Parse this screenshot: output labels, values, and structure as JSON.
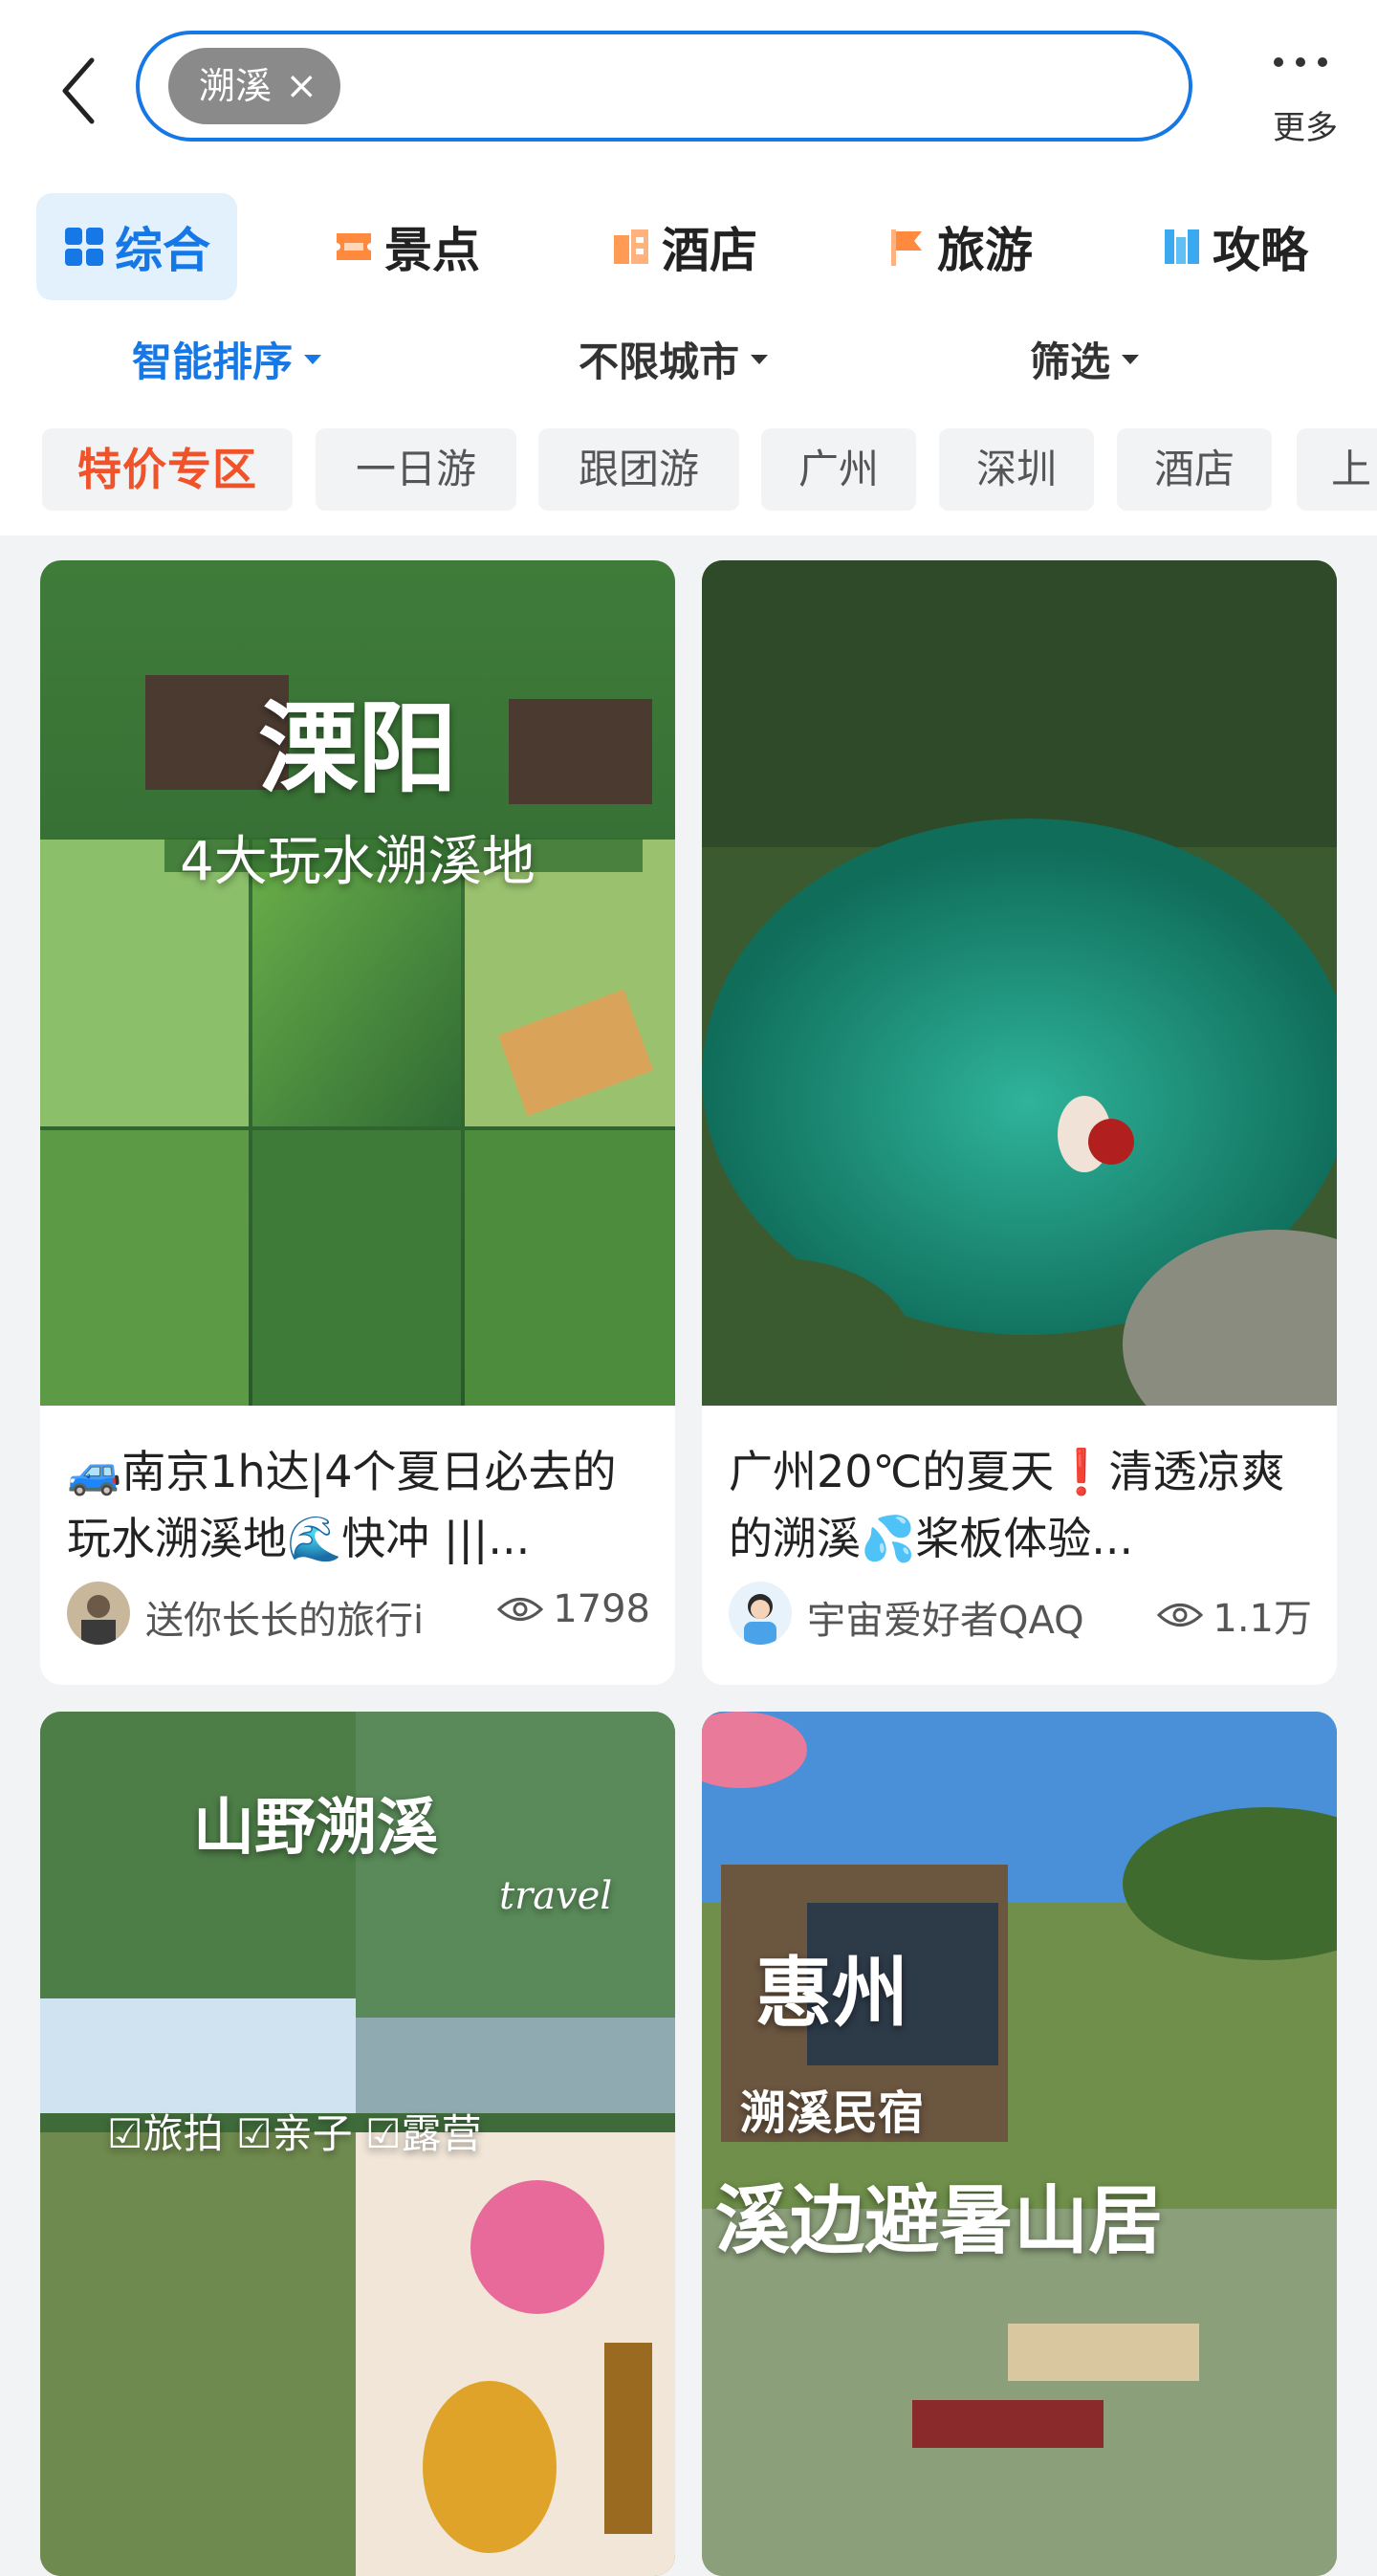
{
  "header": {
    "search_chip": "溯溪",
    "chip_close": "×",
    "more_label": "更多"
  },
  "category_tabs": [
    {
      "label": "综合",
      "icon": "grid-icon",
      "active": true
    },
    {
      "label": "景点",
      "icon": "ticket-icon",
      "active": false
    },
    {
      "label": "酒店",
      "icon": "hotel-icon",
      "active": false
    },
    {
      "label": "旅游",
      "icon": "flag-icon",
      "active": false
    },
    {
      "label": "攻略",
      "icon": "book-icon",
      "active": false
    }
  ],
  "sort_bar": [
    {
      "label": "智能排序",
      "active": true
    },
    {
      "label": "不限城市",
      "active": false
    },
    {
      "label": "筛选",
      "active": false
    }
  ],
  "filter_chips": [
    "特价专区",
    "一日游",
    "跟团游",
    "广州",
    "深圳",
    "酒店",
    "上"
  ],
  "cards": [
    {
      "image_title": "溧阳",
      "image_subtitle": "4大玩水溯溪地",
      "title": "🚙南京1h达|4个夏日必去的玩水溯溪地🌊快冲 |||...",
      "author": "送你长长的旅行i",
      "views": "1798"
    },
    {
      "image_title": "",
      "image_subtitle": "",
      "title": "广州20℃的夏天❗清透凉爽的溯溪💦桨板体验...",
      "author": "宇宙爱好者QAQ",
      "views": "1.1万"
    },
    {
      "image_title": "山野溯溪",
      "image_subtitle": "☑旅拍  ☑亲子  ☑露营",
      "image_extra": "travel"
    },
    {
      "image_title": "惠州",
      "image_subtitle": "溯溪民宿",
      "image_extra": "溪边避暑山居"
    }
  ],
  "colors": {
    "accent": "#1677e6",
    "special": "#f0522a",
    "background": "#f2f3f5"
  }
}
